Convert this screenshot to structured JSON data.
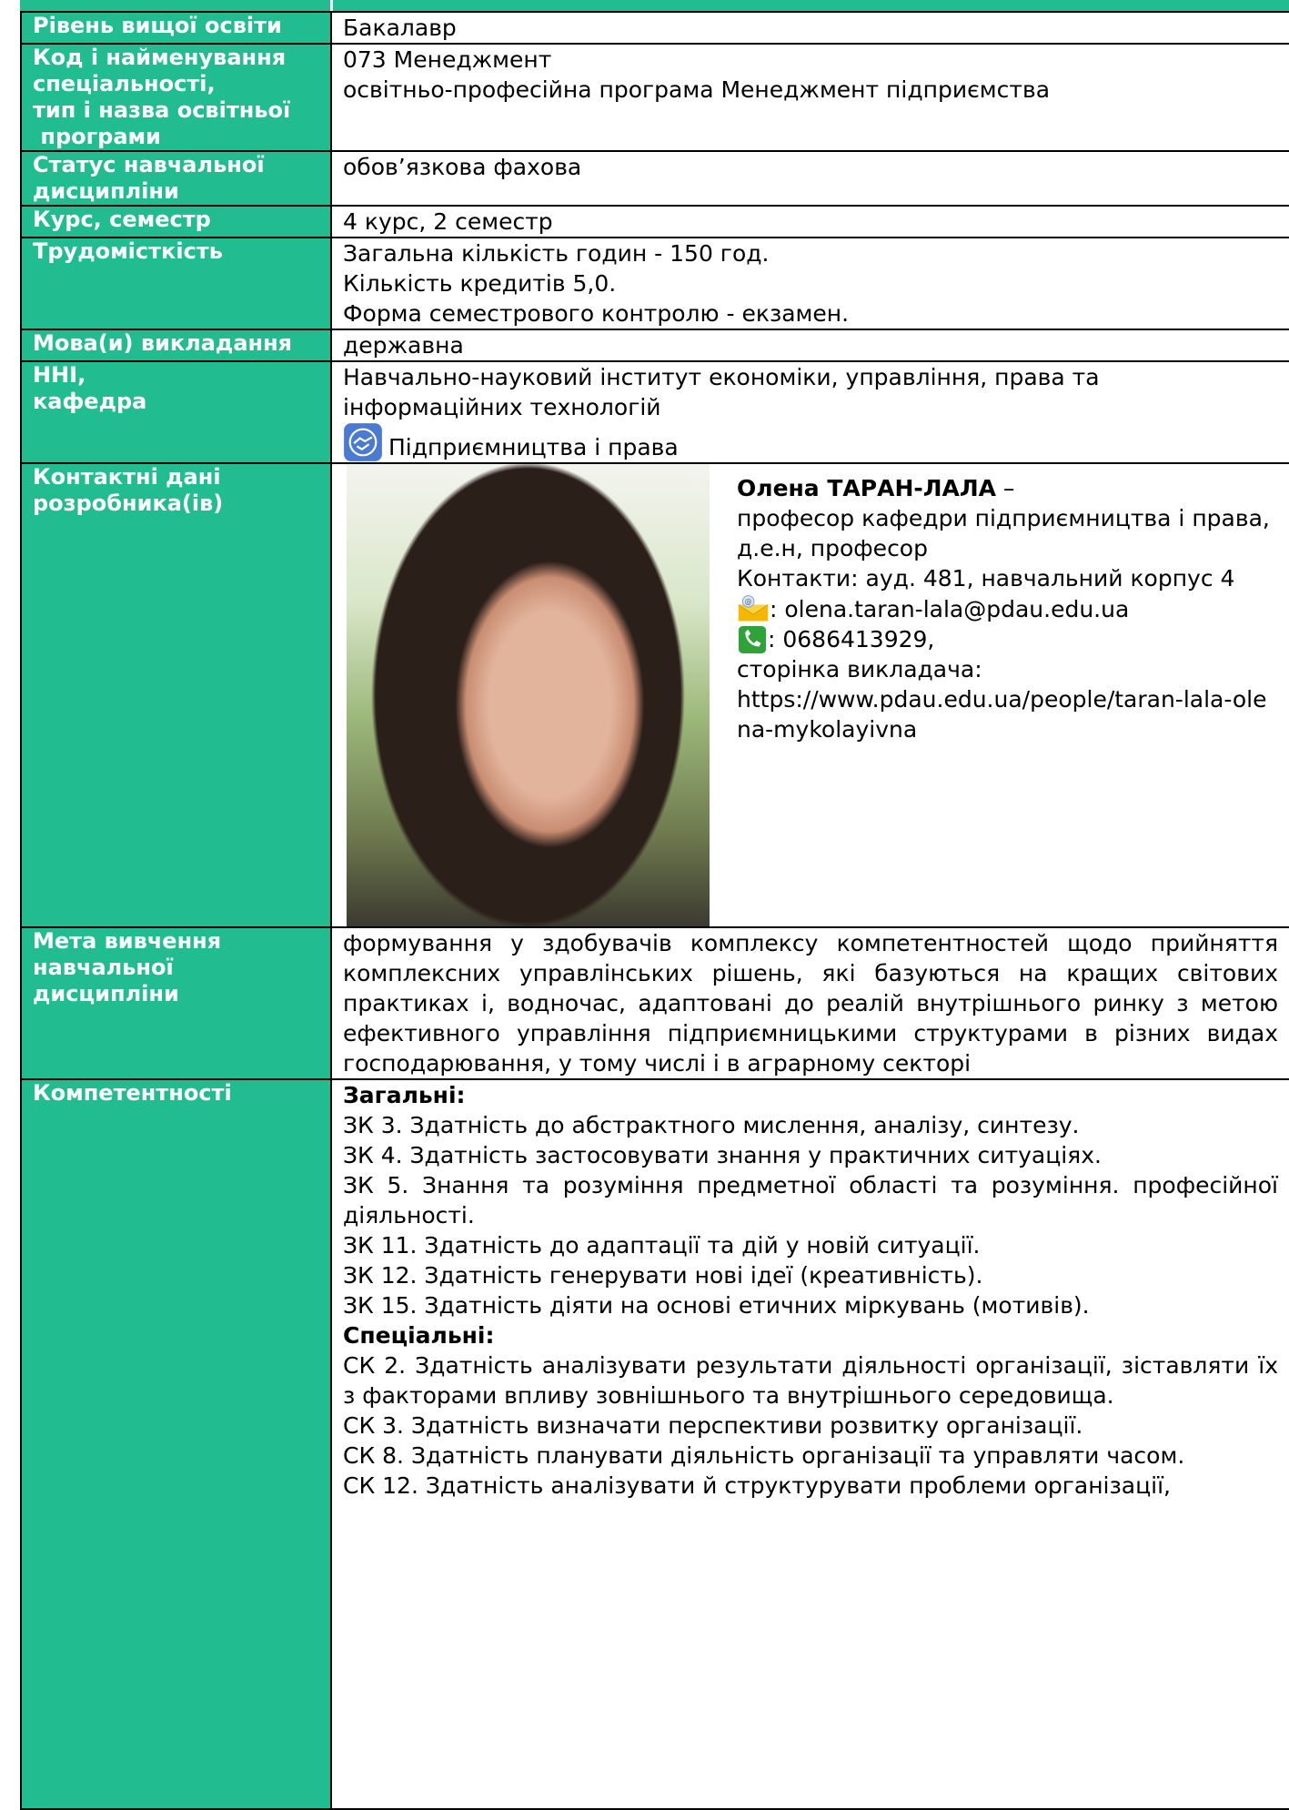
{
  "rows": {
    "level": {
      "label": "Рівень вищої освіти",
      "value": "Бакалавр"
    },
    "specialty": {
      "label_lines": [
        "Код і найменування",
        "спеціальності,",
        "тип і назва освітньої",
        " програми"
      ],
      "value_lines": [
        "073 Менеджмент",
        "освітньо-професійна програма Менеджмент підприємства"
      ]
    },
    "status": {
      "label_lines": [
        "Статус навчальної",
        "дисципліни"
      ],
      "value": "обов’язкова фахова"
    },
    "course": {
      "label": "Курс, семестр",
      "value": "4 курс, 2 семестр"
    },
    "workload": {
      "label": "Трудомісткість",
      "value_lines": [
        "Загальна кількість годин - 150 год.",
        "Кількість кредитів 5,0.",
        "Форма семестрового контролю - екзамен."
      ]
    },
    "language": {
      "label": "Мова(и) викладання",
      "value": "державна"
    },
    "institute": {
      "label_lines": [
        "ННІ,",
        "кафедра"
      ],
      "value_lines": [
        "Навчально-науковий інститут економіки, управління, права та",
        "інформаційних технологій"
      ],
      "department": "Підприємництва і права",
      "department_icon": "handshake-icon"
    },
    "contacts": {
      "label_lines": [
        "Контактні дані",
        "розробника(ів)"
      ],
      "name": "Олена ТАРАН-ЛАЛА",
      "dash": " –",
      "position": "професор кафедри підприємництва і права, д.е.н, професор",
      "room": "Контакти:  ауд. 481, навчальний корпус 4",
      "email": ": olena.taran-lala@pdau.edu.ua",
      "phone": ": 0686413929,",
      "page_label": "сторінка викладача:",
      "page_url": "https://www.pdau.edu.ua/people/taran-lala-olena-mykolayivna"
    },
    "goal": {
      "label_lines": [
        "Мета вивчення",
        "навчальної",
        "дисципліни"
      ],
      "value": "формування у здобувачів комплексу компетентностей щодо прийняття комплексних управлінських рішень, які базуються на кращих світових практиках і, водночас, адаптовані до реалій внутрішнього ринку з метою ефективного управління підприємницькими структурами в різних видах господарювання, у тому числі і в аграрному секторі"
    },
    "competences": {
      "label": "Компетентності",
      "general_title": "Загальні:",
      "general": [
        "ЗК 3. Здатність до абстрактного мислення, аналізу, синтезу.",
        "ЗК 4. Здатність застосовувати знання у практичних ситуаціях.",
        "ЗК 5. Знання та розуміння предметної області та розуміння. професійної діяльності.",
        "ЗК 11. Здатність до адаптації та дій у новій ситуації.",
        "ЗК 12. Здатність генерувати нові ідеї (креативність).",
        "ЗК 15. Здатність діяти на основі етичних міркувань (мотивів)."
      ],
      "special_title": "Спеціальні:",
      "special": [
        "СК 2. Здатність аналізувати результати діяльності організації, зіставляти їх з факторами впливу зовнішнього та внутрішнього середовища.",
        "СК 3. Здатність визначати перспективи розвитку організації.",
        "СК 8. Здатність планувати діяльність організації та управляти часом.",
        "СК 12. Здатність аналізувати й структурувати проблеми організації,"
      ]
    }
  },
  "colors": {
    "label_bg": "#21bd91",
    "label_text": "#ffffff"
  }
}
